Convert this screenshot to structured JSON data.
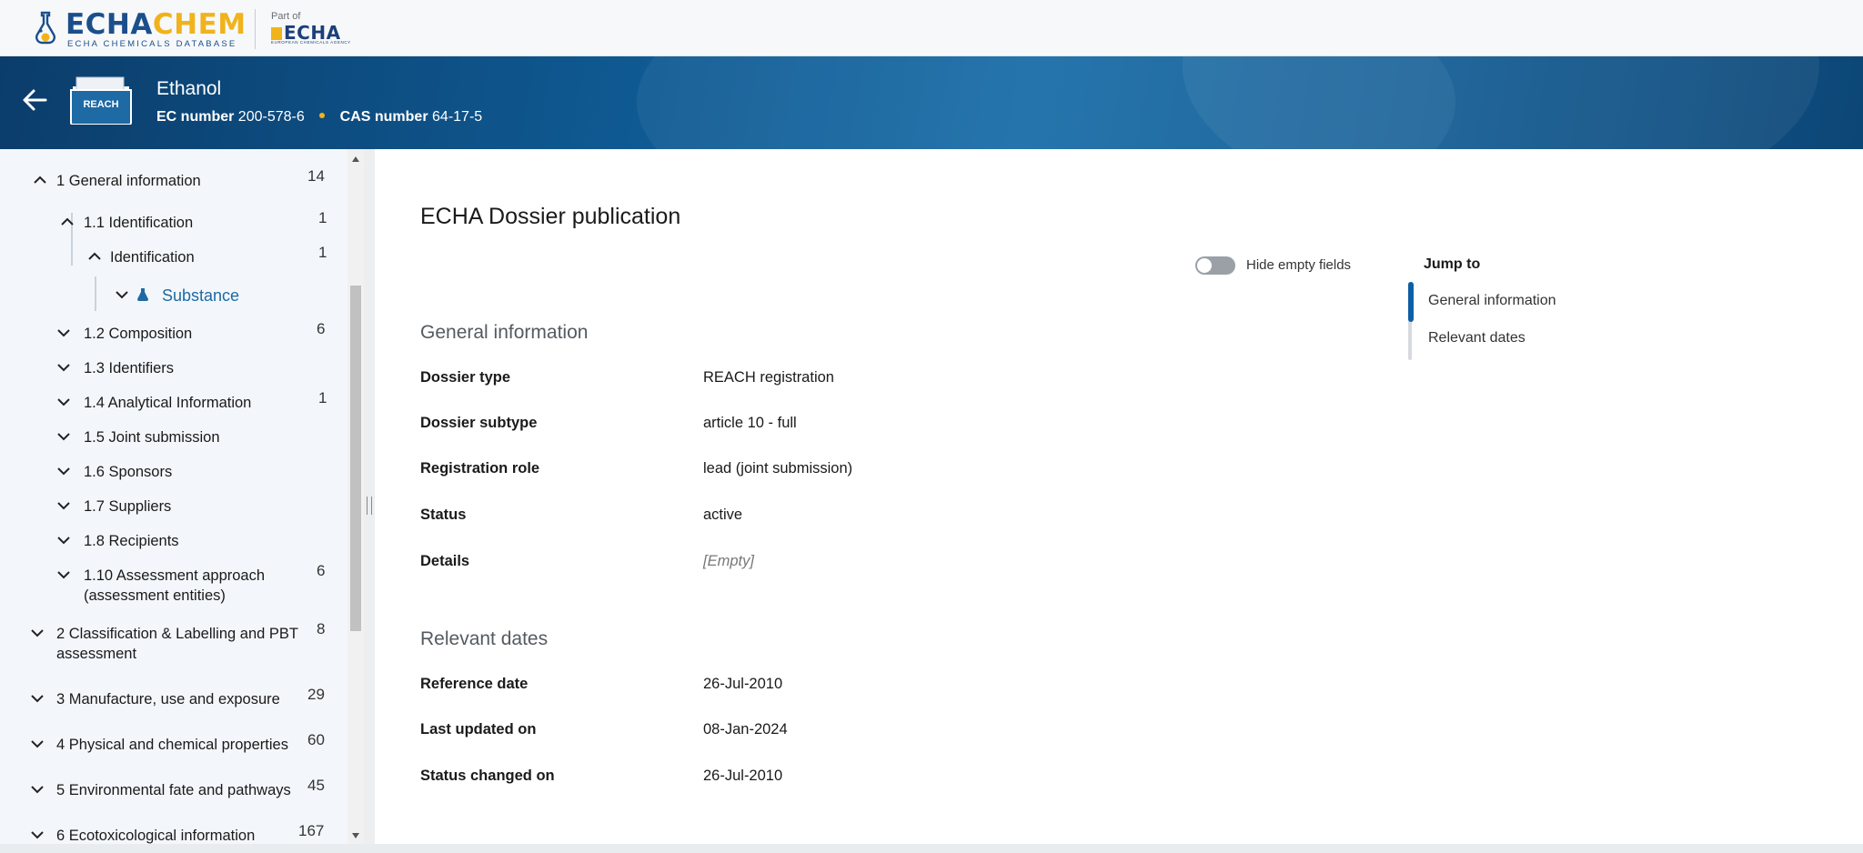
{
  "brand": {
    "logo_part1": "ECHA",
    "logo_part2": "CHEM",
    "logo_subtitle": "ECHA CHEMICALS DATABASE",
    "part_of": "Part of",
    "parent_logo": "ECHA",
    "parent_logo_sub": "EUROPEAN CHEMICALS AGENCY",
    "colors": {
      "primary": "#1b4f8c",
      "accent": "#f0b31c"
    }
  },
  "substance": {
    "folder_badge": "REACH",
    "name": "Ethanol",
    "ec_label": "EC number",
    "ec_value": "200-578-6",
    "cas_label": "CAS number",
    "cas_value": "64-17-5"
  },
  "tree": {
    "items": [
      {
        "label": "1 General information",
        "count": "14",
        "expanded": true
      },
      {
        "label": "1.1 Identification",
        "count": "1",
        "expanded": true
      },
      {
        "label": "Identification",
        "count": "1",
        "expanded": true
      },
      {
        "label": "Substance",
        "count": "",
        "expanded": false,
        "active": true
      },
      {
        "label": "1.2 Composition",
        "count": "6"
      },
      {
        "label": "1.3 Identifiers",
        "count": ""
      },
      {
        "label": "1.4 Analytical Information",
        "count": "1"
      },
      {
        "label": "1.5 Joint submission",
        "count": ""
      },
      {
        "label": "1.6 Sponsors",
        "count": ""
      },
      {
        "label": "1.7 Suppliers",
        "count": ""
      },
      {
        "label": "1.8 Recipients",
        "count": ""
      },
      {
        "label": "1.10 Assessment approach (assessment entities)",
        "count": "6"
      },
      {
        "label": "2 Classification & Labelling and PBT assessment",
        "count": "8"
      },
      {
        "label": "3 Manufacture, use and exposure",
        "count": "29"
      },
      {
        "label": "4 Physical and chemical properties",
        "count": "60"
      },
      {
        "label": "5 Environmental fate and pathways",
        "count": "45"
      },
      {
        "label": "6 Ecotoxicological information",
        "count": "167"
      }
    ]
  },
  "main": {
    "title": "ECHA Dossier publication",
    "hide_empty_label": "Hide empty fields",
    "sections": [
      {
        "title": "General information",
        "fields": [
          {
            "label": "Dossier type",
            "value": "REACH registration"
          },
          {
            "label": "Dossier subtype",
            "value": "article 10 - full"
          },
          {
            "label": "Registration role",
            "value": "lead (joint submission)"
          },
          {
            "label": "Status",
            "value": "active"
          },
          {
            "label": "Details",
            "value": "[Empty]"
          }
        ]
      },
      {
        "title": "Relevant dates",
        "fields": [
          {
            "label": "Reference date",
            "value": "26-Jul-2010"
          },
          {
            "label": "Last updated on",
            "value": "08-Jan-2024"
          },
          {
            "label": "Status changed on",
            "value": "26-Jul-2010"
          }
        ]
      }
    ],
    "jump_to": {
      "title": "Jump to",
      "links": [
        "General information",
        "Relevant dates"
      ]
    }
  }
}
